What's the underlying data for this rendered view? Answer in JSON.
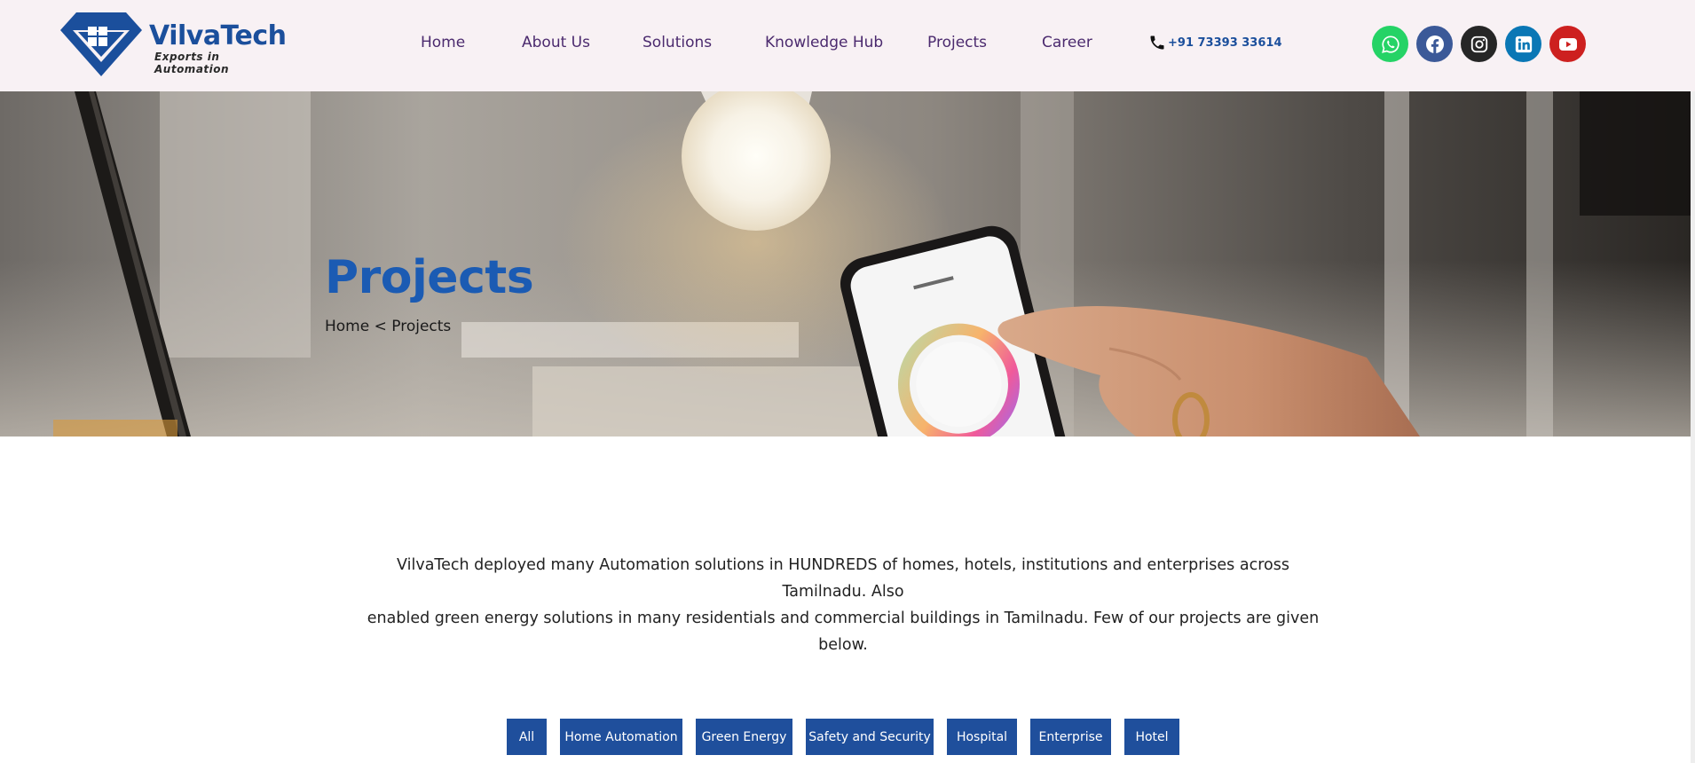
{
  "brand": {
    "name": "VilvaTech",
    "tagline": "Exports in Automation",
    "color": "#1b4f9c"
  },
  "nav": {
    "items": [
      "Home",
      "About Us",
      "Solutions",
      "Knowledge Hub",
      "Projects",
      "Career"
    ],
    "color": "#4b2a6e"
  },
  "contact": {
    "phone": "+91 73393 33614",
    "icon": "phone-icon"
  },
  "social": [
    {
      "name": "whatsapp-icon",
      "color": "#25d366"
    },
    {
      "name": "facebook-icon",
      "color": "#3b5998"
    },
    {
      "name": "instagram-icon",
      "color": "#262626"
    },
    {
      "name": "linkedin-icon",
      "color": "#0a77b5"
    },
    {
      "name": "youtube-icon",
      "color": "#cd201f"
    }
  ],
  "hero": {
    "title": "Projects",
    "breadcrumb": {
      "home": "Home",
      "separator": "<",
      "current": "Projects"
    },
    "image_content": "hand-tapping-smartphone-lights-app-with-bulb"
  },
  "intro": {
    "line1": "VilvaTech deployed many Automation solutions in HUNDREDS of homes, hotels, institutions and enterprises across Tamilnadu. Also",
    "line2": "enabled green energy solutions in many residentials and commercial buildings in Tamilnadu. Few of our projects are given below."
  },
  "filters": {
    "items": [
      "All",
      "Home Automation",
      "Green Energy",
      "Safety and Security",
      "Hospital",
      "Enterprise",
      "Hotel"
    ],
    "color": "#1f4f9c"
  }
}
